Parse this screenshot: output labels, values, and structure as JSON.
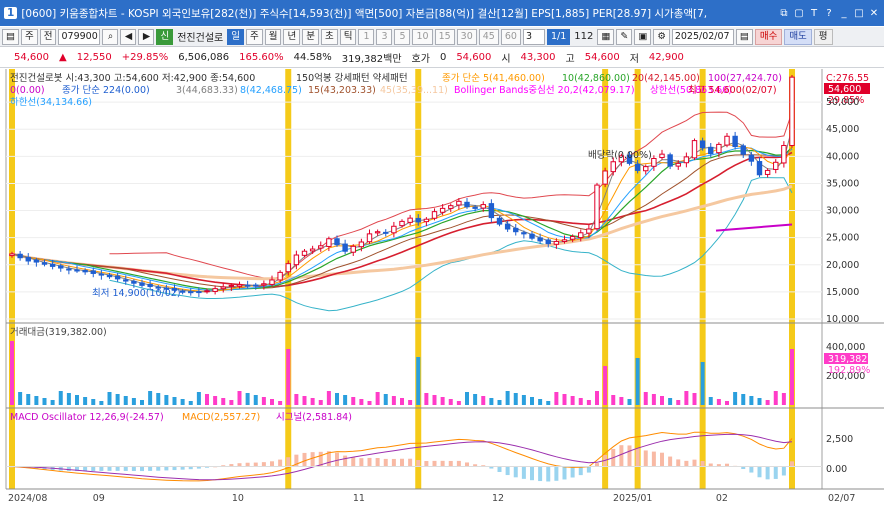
{
  "window": {
    "number": "1",
    "title": "[0600] 키움종합차트 - KOSPI 외국인보유[282(천)] 주식수[14,593(천)] 액면[500] 자본금[88(억)] 결산[12월] EPS[1,885] PER[28.97] 시가총액[7,",
    "icons": [
      "restore-icon",
      "pin-icon",
      "font-icon",
      "help-icon",
      "minimize-icon",
      "maximize-icon",
      "close-icon"
    ]
  },
  "toolbar": {
    "type_label": "주",
    "total_label": "전",
    "code": "079900",
    "stock_name": "전진건설로",
    "periods": [
      "일",
      "주",
      "월",
      "년",
      "분",
      "초",
      "틱"
    ],
    "selected_period": "일",
    "intervals": [
      "1",
      "3",
      "5",
      "10",
      "15",
      "30",
      "45",
      "60"
    ],
    "interval_value": "3",
    "ratio_label": "112",
    "date": "2025/02/07",
    "buy": "매수",
    "sell": "매도",
    "eval": "평"
  },
  "price": {
    "current": "54,600",
    "arrow": "▲",
    "change": "12,550",
    "change_pct": "+29.85%",
    "volume": "6,506,086",
    "vol_ratio": "165.60%",
    "turnover": "44.58%",
    "amount": "319,382백만",
    "quote_label": "호가",
    "quote": "0",
    "quote_price": "54,600",
    "open_label": "시",
    "open": "43,300",
    "high_label": "고",
    "high": "54,600",
    "low_label": "저",
    "low": "42,900"
  },
  "legend": {
    "main": "전진건설로봇 시:43,300 고:54,600 저:42,900 종:54,600",
    "pattern": "150억봉 강세패턴  약세패턴",
    "ma5": "종가 단순 5(41,460.00)",
    "ma10": "10(42,860.00)",
    "ma20": "20(42,145.00)",
    "ma100": "100(27,424.70)",
    "ma_flag": "0(0.00)",
    "ma224": "종가 단순 224(0.00)",
    "ma3": "3(44,683.33)",
    "ma8": "8(42,468.75)",
    "ma15": "15(43,203.33)",
    "ma45": "45(35,39...11)",
    "boll": "Bollinger Bands중심선 20,2(42,079.17)",
    "boll_upper": "상한선(50,863.60)",
    "boll_lower": "하한선(34,134.66)",
    "low_marker": "최저 14,900(10/02)",
    "high_marker": "최고 54,600(02/07)",
    "dividend": "배당락(0.00%)",
    "ratio_label": "C:276.55",
    "price_tag": "54,600",
    "pct_tag": "29.85%"
  },
  "price_axis": [
    "50,000",
    "45,000",
    "40,000",
    "35,000",
    "30,000",
    "25,000",
    "20,000",
    "15,000",
    "10,000"
  ],
  "volume": {
    "title": "거래대금(319,382.00)",
    "axis": [
      "400,000",
      "200,000"
    ],
    "tag_value": "319,382",
    "tag_pct": "192.89%"
  },
  "macd": {
    "osc": "MACD Oscillator 12,26,9(-24.57)",
    "macd": "MACD(2,557.27)",
    "signal": "시그널(2,581.84)",
    "axis": [
      "2,500",
      "0.00"
    ]
  },
  "date_axis": [
    "2024/08",
    "09",
    "10",
    "11",
    "12",
    "2025/01",
    "02",
    "02/07"
  ],
  "colors": {
    "up": "#e0002a",
    "down": "#1f5fd0",
    "signal_band": "#f4c400",
    "vol_up": "#ff3cc8",
    "vol_down": "#2a9fdd",
    "ma5": "#ff9a00",
    "ma10": "#2aa52a",
    "ma20": "#d61f2f",
    "ma100": "#c800c8",
    "ma3": "#808080",
    "ma8": "#24a0ff",
    "ma15": "#a0522d",
    "ma45": "#f5c8a0",
    "boll": "#ff00ff"
  },
  "chart_data": {
    "type": "candlestick",
    "price_range": [
      10000,
      55000
    ],
    "closes": [
      22000,
      21300,
      20700,
      20500,
      20100,
      19700,
      19400,
      19100,
      18900,
      18700,
      18400,
      18100,
      17800,
      17400,
      17000,
      16600,
      16200,
      16000,
      15700,
      15500,
      15300,
      15100,
      15000,
      14900,
      15200,
      15600,
      15900,
      16200,
      16300,
      16200,
      16100,
      16500,
      17200,
      18600,
      20200,
      21800,
      22500,
      22900,
      23500,
      24800,
      23700,
      22500,
      23400,
      24200,
      25700,
      26100,
      25900,
      27100,
      28000,
      28600,
      27900,
      28400,
      29800,
      30400,
      30900,
      31700,
      30700,
      30400,
      31100,
      28700,
      27500,
      26600,
      26100,
      25700,
      24900,
      24400,
      23900,
      24300,
      24600,
      25200,
      25900,
      26600,
      34700,
      37300,
      39000,
      40100,
      38700,
      37400,
      38100,
      39600,
      40400,
      38200,
      38700,
      39900,
      42900,
      41600,
      40500,
      42200,
      43700,
      41800,
      40400,
      39100,
      36600,
      37400,
      38900,
      42000,
      54600
    ],
    "volume_highlights": [
      0,
      34,
      50,
      73,
      77,
      85,
      96
    ],
    "macd_range": [
      -2000,
      4500
    ]
  }
}
